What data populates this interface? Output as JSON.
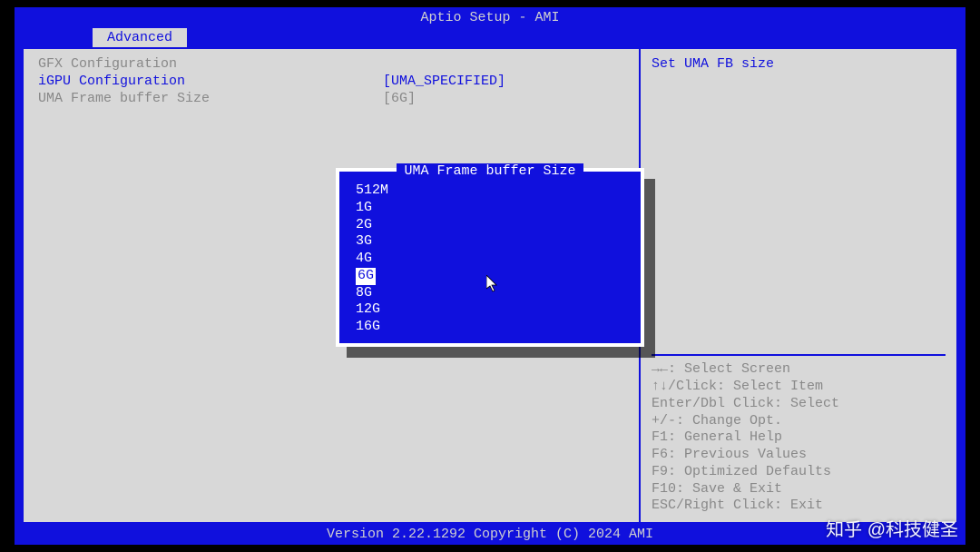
{
  "header": {
    "title": "Aptio Setup - AMI"
  },
  "tab": {
    "label": "Advanced"
  },
  "main": {
    "rows": [
      {
        "label": "GFX Configuration",
        "value": ""
      },
      {
        "label": "iGPU Configuration",
        "value": "[UMA_SPECIFIED]"
      },
      {
        "label": "UMA Frame buffer Size",
        "value": "[6G]"
      }
    ]
  },
  "side": {
    "help": "Set UMA FB size",
    "hints": [
      "→←: Select Screen",
      "↑↓/Click: Select Item",
      "Enter/Dbl Click: Select",
      "+/-: Change Opt.",
      "F1: General Help",
      "F6: Previous Values",
      "F9: Optimized Defaults",
      "F10: Save & Exit",
      "ESC/Right Click: Exit"
    ]
  },
  "popup": {
    "title": "UMA Frame buffer Size",
    "options": [
      "512M",
      "1G",
      "2G",
      "3G",
      "4G",
      "6G",
      "8G",
      "12G",
      "16G"
    ],
    "selected": "6G"
  },
  "footer": {
    "text": "Version 2.22.1292 Copyright (C) 2024 AMI"
  },
  "watermark": {
    "text": "知乎 @科技健圣"
  }
}
